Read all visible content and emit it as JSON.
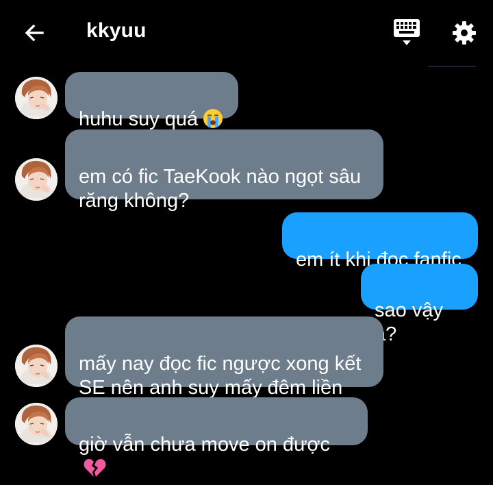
{
  "header": {
    "title": "kkyuu",
    "icons": {
      "back": "arrow-left-icon",
      "keyboard": "keyboard-icon",
      "settings": "gear-icon"
    }
  },
  "colors": {
    "background": "#000000",
    "incoming_bubble": "#6e7d8c",
    "outgoing_bubble": "#1aa1ff",
    "text": "#ffffff"
  },
  "messages": [
    {
      "sender": "contact",
      "text": "huhu suy quá",
      "emoji": "loudly-crying-face-emoji"
    },
    {
      "sender": "contact",
      "text": "em có fic TaeKook nào ngọt sâu\nrăng không?"
    },
    {
      "sender": "me",
      "text": "em ít khi đọc fanfic"
    },
    {
      "sender": "me",
      "text": "sao vậy ạ?"
    },
    {
      "sender": "contact",
      "text": "mấy nay đọc fic ngược xong kết\nSE nên anh suy mấy đêm liền"
    },
    {
      "sender": "contact",
      "text": "giờ vẫn chưa move on được",
      "emoji": "broken-heart-emoji"
    }
  ]
}
